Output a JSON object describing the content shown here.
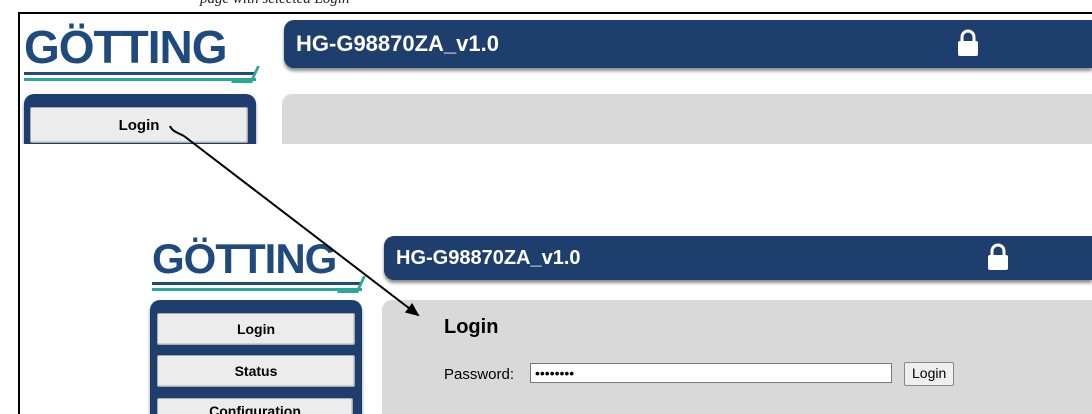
{
  "caption": "page with selected Login",
  "app": {
    "title": "HG-G98870ZA_v1.0",
    "logo_text": "GÖTTING"
  },
  "top_view": {
    "sidebar": {
      "items": [
        {
          "label": "Login"
        }
      ]
    }
  },
  "bottom_view": {
    "sidebar": {
      "items": [
        {
          "label": "Login"
        },
        {
          "label": "Status"
        },
        {
          "label": "Configuration"
        }
      ]
    },
    "login_form": {
      "heading": "Login",
      "password_label": "Password:",
      "password_value": "••••••••",
      "submit_label": "Login"
    }
  },
  "colors": {
    "brand_blue": "#1e3e6e",
    "logo_blue": "#1e4a7e",
    "logo_accent": "#2aa89a",
    "content_gray": "#d9d9d9"
  },
  "icons": [
    "lock-icon",
    "arrow-pointer"
  ]
}
